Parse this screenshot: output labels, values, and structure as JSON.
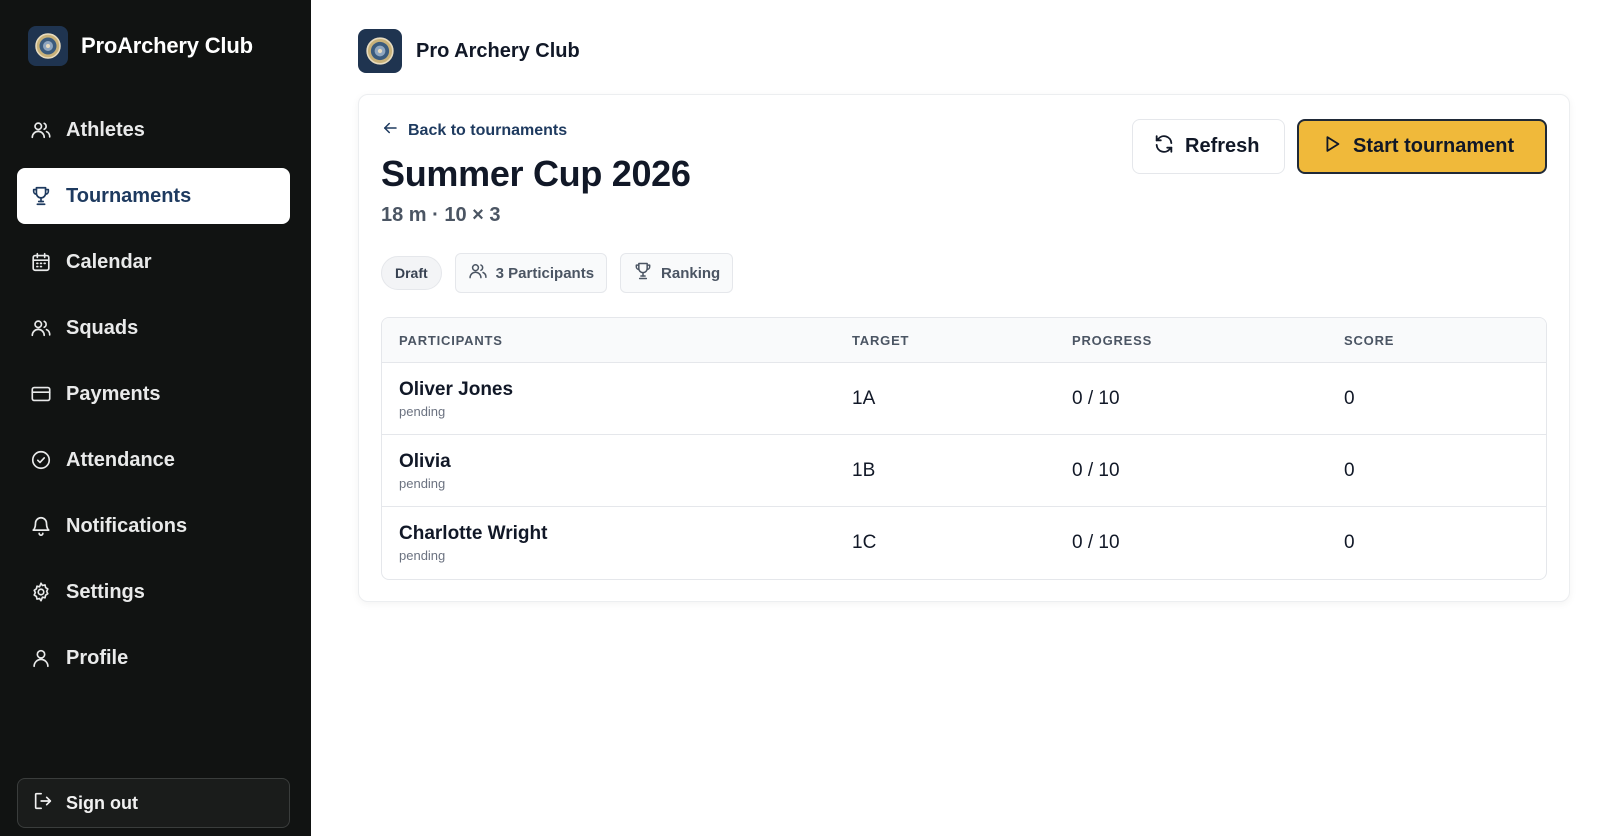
{
  "sidebar": {
    "brand": "ProArchery Club",
    "items": [
      {
        "label": "Athletes",
        "icon": "users-icon",
        "active": false
      },
      {
        "label": "Tournaments",
        "icon": "trophy-icon",
        "active": true
      },
      {
        "label": "Calendar",
        "icon": "calendar-icon",
        "active": false
      },
      {
        "label": "Squads",
        "icon": "users-icon",
        "active": false
      },
      {
        "label": "Payments",
        "icon": "credit-card-icon",
        "active": false
      },
      {
        "label": "Attendance",
        "icon": "check-circle-icon",
        "active": false
      },
      {
        "label": "Notifications",
        "icon": "bell-icon",
        "active": false
      },
      {
        "label": "Settings",
        "icon": "gear-icon",
        "active": false
      },
      {
        "label": "Profile",
        "icon": "user-icon",
        "active": false
      }
    ],
    "signout_label": "Sign out"
  },
  "header": {
    "title": "Pro Archery Club"
  },
  "tournament": {
    "back_label": "Back to tournaments",
    "title": "Summer Cup 2026",
    "subtitle": "18 m · 10 × 3",
    "refresh_label": "Refresh",
    "start_label": "Start tournament",
    "status_badge": "Draft",
    "participants_chip": "3 Participants",
    "ranking_chip": "Ranking"
  },
  "table": {
    "columns": [
      "PARTICIPANTS",
      "TARGET",
      "PROGRESS",
      "SCORE"
    ],
    "rows": [
      {
        "name": "Oliver Jones",
        "status": "pending",
        "target": "1A",
        "progress": "0 / 10",
        "score": "0"
      },
      {
        "name": "Olivia",
        "status": "pending",
        "target": "1B",
        "progress": "0 / 10",
        "score": "0"
      },
      {
        "name": "Charlotte Wright",
        "status": "pending",
        "target": "1C",
        "progress": "0 / 10",
        "score": "0"
      }
    ]
  },
  "colors": {
    "sidebar_bg": "#111312",
    "accent_navy": "#1e3a5f",
    "start_button": "#f0b93a"
  }
}
